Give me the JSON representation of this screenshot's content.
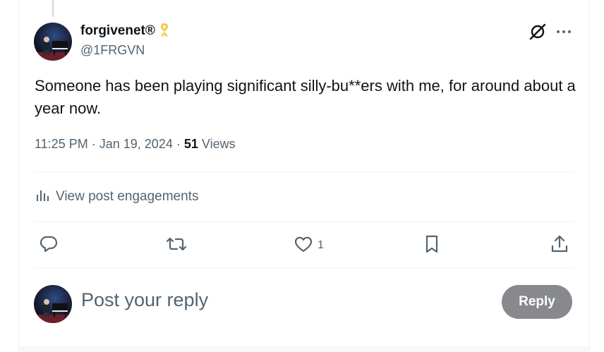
{
  "post": {
    "author": {
      "display_name": "forgivenet®",
      "handle": "@1FRGVN",
      "badge_icon": "yellow-ribbon-icon",
      "avatar_icon": "pianist-avatar"
    },
    "text": "Someone has been playing significant silly-bu**ers with me, for around about a year now.",
    "meta": {
      "time": "11:25 PM",
      "date": "Jan 19, 2024",
      "separator": "·",
      "views_count": "51",
      "views_label": "Views"
    },
    "engagements_label": "View post engagements",
    "actions": {
      "reply_icon": "reply-icon",
      "repost_icon": "repost-icon",
      "like_icon": "heart-icon",
      "like_count": "1",
      "bookmark_icon": "bookmark-icon",
      "share_icon": "share-icon"
    }
  },
  "reply_composer": {
    "placeholder": "Post your reply",
    "button_label": "Reply"
  },
  "colors": {
    "text_primary": "#0f1419",
    "text_secondary": "#536471",
    "reply_button_disabled": "#87898c",
    "ribbon": "#f4c542"
  }
}
